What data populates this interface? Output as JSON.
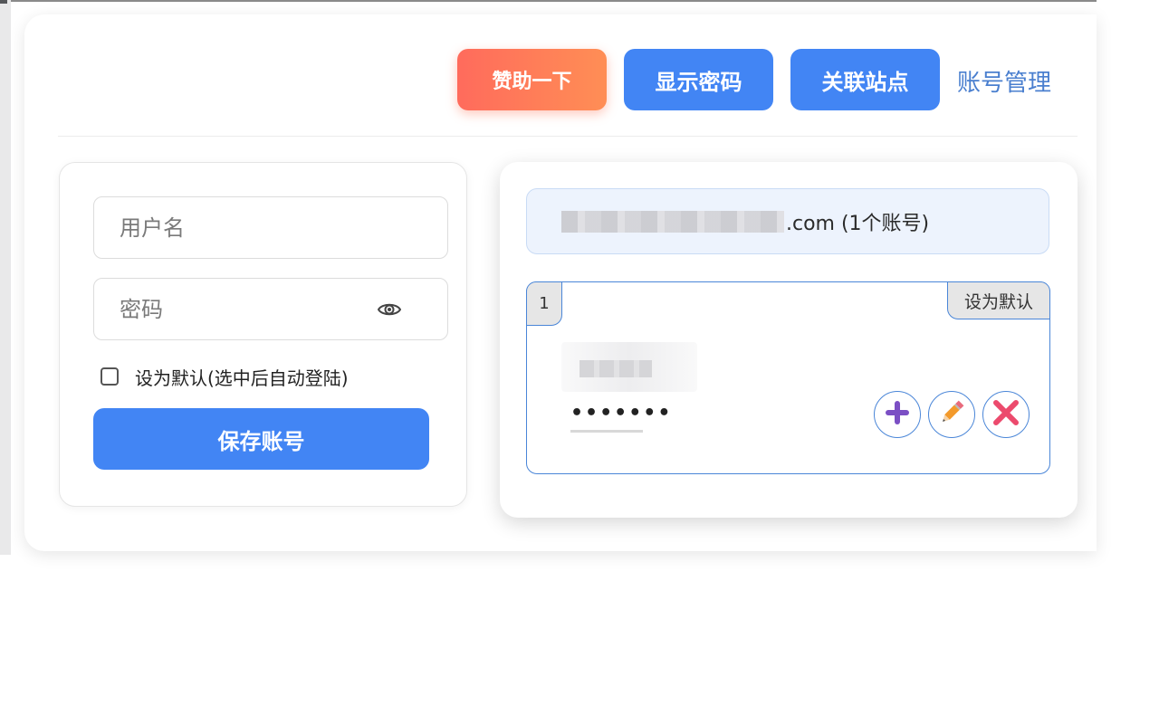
{
  "toolbar": {
    "sponsor_label": "赞助一下",
    "show_password_label": "显示密码",
    "link_site_label": "关联站点",
    "account_manage_label": "账号管理"
  },
  "form": {
    "username_placeholder": "用户名",
    "password_placeholder": "密码",
    "default_checkbox_label": "设为默认(选中后自动登陆)",
    "save_label": "保存账号"
  },
  "site": {
    "label": ".com (1个账号)"
  },
  "accounts": [
    {
      "index": "1",
      "set_default_label": "设为默认",
      "password_mask": "•••••••"
    }
  ],
  "icons": {
    "eye": "eye-icon",
    "add": "plus-icon",
    "edit": "pencil-icon",
    "delete": "close-icon"
  },
  "colors": {
    "primary": "#4285f4",
    "sponsor_start": "#ff6b5c",
    "sponsor_end": "#ff8e55",
    "link": "#4a7fcf",
    "item_border": "#4a86d8"
  }
}
